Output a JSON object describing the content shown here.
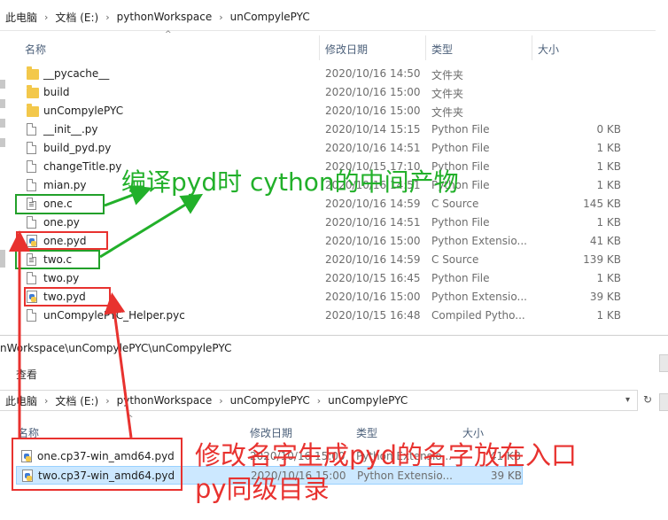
{
  "top_window": {
    "breadcrumbs": [
      "此电脑",
      "文档 (E:)",
      "pythonWorkspace",
      "unCompylePYC"
    ],
    "columns": {
      "name": "名称",
      "date": "修改日期",
      "type": "类型",
      "size": "大小"
    },
    "files": [
      {
        "name": "__pycache__",
        "date": "2020/10/16 14:50",
        "type": "文件夹",
        "size": "",
        "icon": "folder-icon"
      },
      {
        "name": "build",
        "date": "2020/10/16 15:00",
        "type": "文件夹",
        "size": "",
        "icon": "folder-icon"
      },
      {
        "name": "unCompylePYC",
        "date": "2020/10/16 15:00",
        "type": "文件夹",
        "size": "",
        "icon": "folder-icon"
      },
      {
        "name": "__init__.py",
        "date": "2020/10/14 15:15",
        "type": "Python File",
        "size": "0 KB",
        "icon": "file-icon"
      },
      {
        "name": "build_pyd.py",
        "date": "2020/10/16 14:51",
        "type": "Python File",
        "size": "1 KB",
        "icon": "file-icon"
      },
      {
        "name": "changeTitle.py",
        "date": "2020/10/15 17:10",
        "type": "Python File",
        "size": "1 KB",
        "icon": "file-icon"
      },
      {
        "name": "mian.py",
        "date": "2020/10/16 14:51",
        "type": "Python File",
        "size": "1 KB",
        "icon": "file-icon"
      },
      {
        "name": "one.c",
        "date": "2020/10/16 14:59",
        "type": "C Source",
        "size": "145 KB",
        "icon": "c-source-icon"
      },
      {
        "name": "one.py",
        "date": "2020/10/16 14:51",
        "type": "Python File",
        "size": "1 KB",
        "icon": "file-icon"
      },
      {
        "name": "one.pyd",
        "date": "2020/10/16 15:00",
        "type": "Python Extensio...",
        "size": "41 KB",
        "icon": "pyd-icon"
      },
      {
        "name": "two.c",
        "date": "2020/10/16 14:59",
        "type": "C Source",
        "size": "139 KB",
        "icon": "c-source-icon"
      },
      {
        "name": "two.py",
        "date": "2020/10/15 16:45",
        "type": "Python File",
        "size": "1 KB",
        "icon": "file-icon"
      },
      {
        "name": "two.pyd",
        "date": "2020/10/16 15:00",
        "type": "Python Extensio...",
        "size": "39 KB",
        "icon": "pyd-icon"
      },
      {
        "name": "unCompylePYC_Helper.pyc",
        "date": "2020/10/15 16:48",
        "type": "Compiled Pytho...",
        "size": "1 KB",
        "icon": "file-icon"
      }
    ]
  },
  "bottom_window": {
    "title": "nWorkspace\\unCompylePYC\\unCompylePYC",
    "menu": "查看",
    "breadcrumbs": [
      "此电脑",
      "文档 (E:)",
      "pythonWorkspace",
      "unCompylePYC",
      "unCompylePYC"
    ],
    "columns": {
      "name": "名称",
      "date": "修改日期",
      "type": "类型",
      "size": "大小"
    },
    "files": [
      {
        "name": "one.cp37-win_amd64.pyd",
        "date": "2020/10/16 15:00",
        "type": "Python Extensio...",
        "size": "41 KB",
        "icon": "pyd-icon"
      },
      {
        "name": "two.cp37-win_amd64.pyd",
        "date": "2020/10/16 15:00",
        "type": "Python Extensio...",
        "size": "39 KB",
        "icon": "pyd-icon"
      }
    ]
  },
  "annotations": {
    "green_text": "编译pyd时 cython的中间产物",
    "red_text_line1": "修改名字生成pyd的名字放在入口",
    "red_text_line2": "py同级目录",
    "green_color": "#22b02a",
    "red_color": "#e8322f"
  }
}
